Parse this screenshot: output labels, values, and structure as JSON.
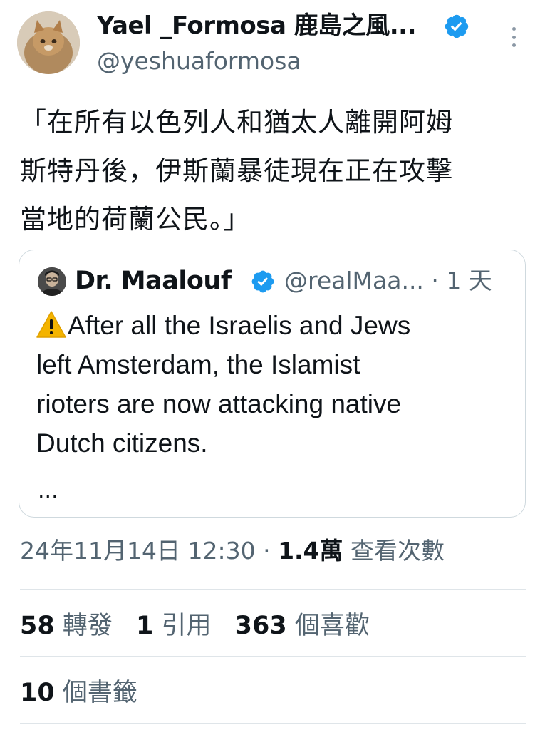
{
  "author": {
    "display_name": "Yael _Formosa 鹿島之風...",
    "handle": "@yeshuaformosa",
    "verified_color": "#1d9bf0"
  },
  "tweet": {
    "text_lines": [
      "「在所有以色列人和猶太人離開阿姆",
      "斯特丹後，伊斯蘭暴徒現在正在攻擊",
      "當地的荷蘭公民。」"
    ]
  },
  "quote": {
    "name": "Dr. Maalouf",
    "handle": "@realMaa...",
    "time": "· 1 天",
    "warning_icon": "warning-icon",
    "text_lines": [
      "After all the Israelis and Jews",
      "left Amsterdam, the Islamist",
      "rioters are now attacking native",
      "Dutch citizens."
    ],
    "ellipsis": "..."
  },
  "meta": {
    "timestamp": "24年11月14日 12:30",
    "separator": " · ",
    "views_count": "1.4萬",
    "views_label": " 查看次數"
  },
  "stats": {
    "retweets_count": "58",
    "retweets_label": " 轉發",
    "quotes_count": "1",
    "quotes_label": " 引用",
    "likes_count": "363",
    "likes_label": " 個喜歡",
    "bookmarks_count": "10",
    "bookmarks_label": " 個書籤"
  },
  "colors": {
    "text": "#0f1419",
    "secondary": "#536471",
    "border": "#cfd9de",
    "verified": "#1d9bf0",
    "warning": "#f4b400"
  }
}
